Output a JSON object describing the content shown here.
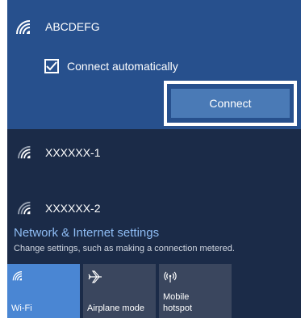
{
  "selected_network": {
    "name": "ABCDEFG",
    "connect_automatically_label": "Connect automatically",
    "connect_automatically_checked": true,
    "connect_label": "Connect"
  },
  "networks": [
    {
      "name": "XXXXXX-1"
    },
    {
      "name": "XXXXXX-2"
    }
  ],
  "settings": {
    "link_label": "Network & Internet settings",
    "description": "Change settings, such as making a connection metered."
  },
  "quick_actions": [
    {
      "label": "Wi-Fi",
      "icon": "wifi-icon",
      "active": true
    },
    {
      "label": "Airplane mode",
      "icon": "airplane-icon",
      "active": false
    },
    {
      "label": "Mobile\nhotspot",
      "icon": "hotspot-icon",
      "active": false
    }
  ],
  "colors": {
    "panel_bg": "#1b2b48",
    "selected_bg": "#27508d",
    "connect_button": "#4a7ab6",
    "link": "#8fbdf5",
    "tile_active": "#4a86d3",
    "tile_inactive": "#3a465e"
  }
}
